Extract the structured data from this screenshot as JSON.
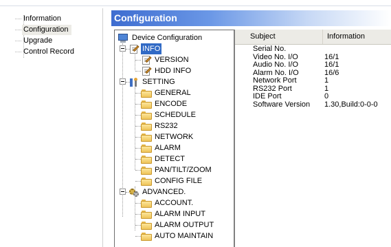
{
  "nav": {
    "items": [
      {
        "label": "Information"
      },
      {
        "label": "Configuration"
      },
      {
        "label": "Upgrade"
      },
      {
        "label": "Control Record"
      }
    ]
  },
  "header": {
    "title": "Configuration"
  },
  "tree": {
    "root": "Device Configuration",
    "info": {
      "label": "INFO",
      "children": [
        "VERSION",
        "HDD INFO"
      ]
    },
    "setting": {
      "label": "SETTING",
      "children": [
        "GENERAL",
        "ENCODE",
        "SCHEDULE",
        "RS232",
        "NETWORK",
        "ALARM",
        "DETECT",
        "PAN/TILT/ZOOM",
        "CONFIG FILE"
      ]
    },
    "advanced": {
      "label": "ADVANCED.",
      "children": [
        "ACCOUNT.",
        "ALARM INPUT",
        "ALARM OUTPUT",
        "AUTO MAINTAIN"
      ]
    }
  },
  "info_table": {
    "columns": [
      "Subject",
      "Information"
    ],
    "rows": [
      {
        "subject": "Serial No.",
        "value": ""
      },
      {
        "subject": "Video No. I/O",
        "value": "16/1"
      },
      {
        "subject": "Audio No. I/O",
        "value": "16/1"
      },
      {
        "subject": "Alarm No. I/O",
        "value": "16/6"
      },
      {
        "subject": "Network Port",
        "value": "1"
      },
      {
        "subject": "RS232 Port",
        "value": "1"
      },
      {
        "subject": "IDE Port",
        "value": "0"
      },
      {
        "subject": "Software Version",
        "value": "1.30,Build:0-0-0"
      }
    ]
  },
  "colors": {
    "header_start": "#3e6dd0",
    "selection": "#316ac5",
    "folder": "#efc55a"
  }
}
